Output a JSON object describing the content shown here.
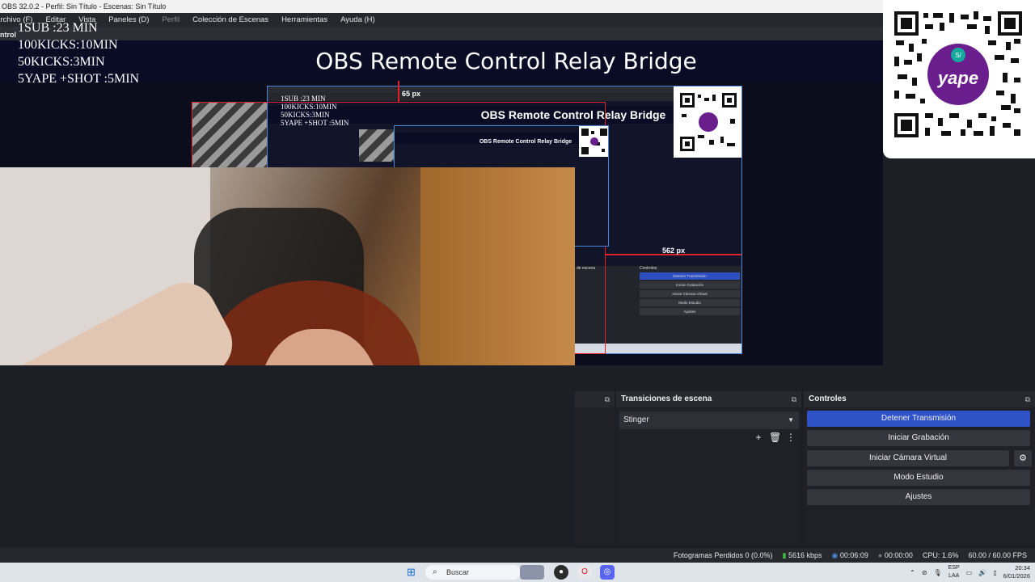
{
  "window": {
    "title": "OBS 32.0.2 - Perfil: Sin Título - Escenas: Sin Título"
  },
  "menu": {
    "items": [
      "Archivo (F)",
      "Editar",
      "Vista",
      "Paneles (D)",
      "Perfil",
      "Colección de Escenas",
      "Herramientas",
      "Ayuda (H)"
    ],
    "sub_label": "ntrol"
  },
  "preview": {
    "banner_title": "OBS Remote Control Relay Bridge",
    "overlay_lines": [
      "1SUB :23 MIN",
      "100KICKS:10MIN",
      "50KICKS:3MIN",
      "5YAPE +SHOT :5MIN"
    ],
    "measure_top": "65 px",
    "measure_right": "562 px",
    "qr_brand": "yape",
    "mirror": {
      "controls_title": "Controles",
      "controls": [
        "Detener Transmisión",
        "Iniciar Grabación",
        "Iniciar Cámara Virtual",
        "Modo Estudio",
        "Ajustes"
      ],
      "dock_left": "de escena"
    }
  },
  "docks": {
    "transitions": {
      "title": "Transiciones de escena",
      "selected": "Stinger"
    },
    "controls": {
      "title": "Controles",
      "buttons": {
        "stop_stream": "Detener Transmisión",
        "start_recording": "Iniciar Grabación",
        "start_virtual_cam": "Iniciar Cámara Virtual",
        "studio_mode": "Modo Estudio",
        "settings": "Ajustes"
      }
    }
  },
  "status": {
    "dropped_frames": "Fotogramas Perdidos 0 (0.0%)",
    "bitrate": "5616 kbps",
    "stream_time": "00:06:09",
    "rec_time": "00:00:00",
    "cpu": "CPU: 1.6%",
    "fps": "60.00 / 60.00 FPS"
  },
  "taskbar": {
    "search_label": "Buscar",
    "lang_top": "ESP",
    "lang_bottom": "LAA",
    "time": "20:34",
    "date": "6/01/2026"
  },
  "colors": {
    "accent_blue": "#2f52c7",
    "measure_red": "#e0202a",
    "banner_bg": "#0a0b25"
  }
}
